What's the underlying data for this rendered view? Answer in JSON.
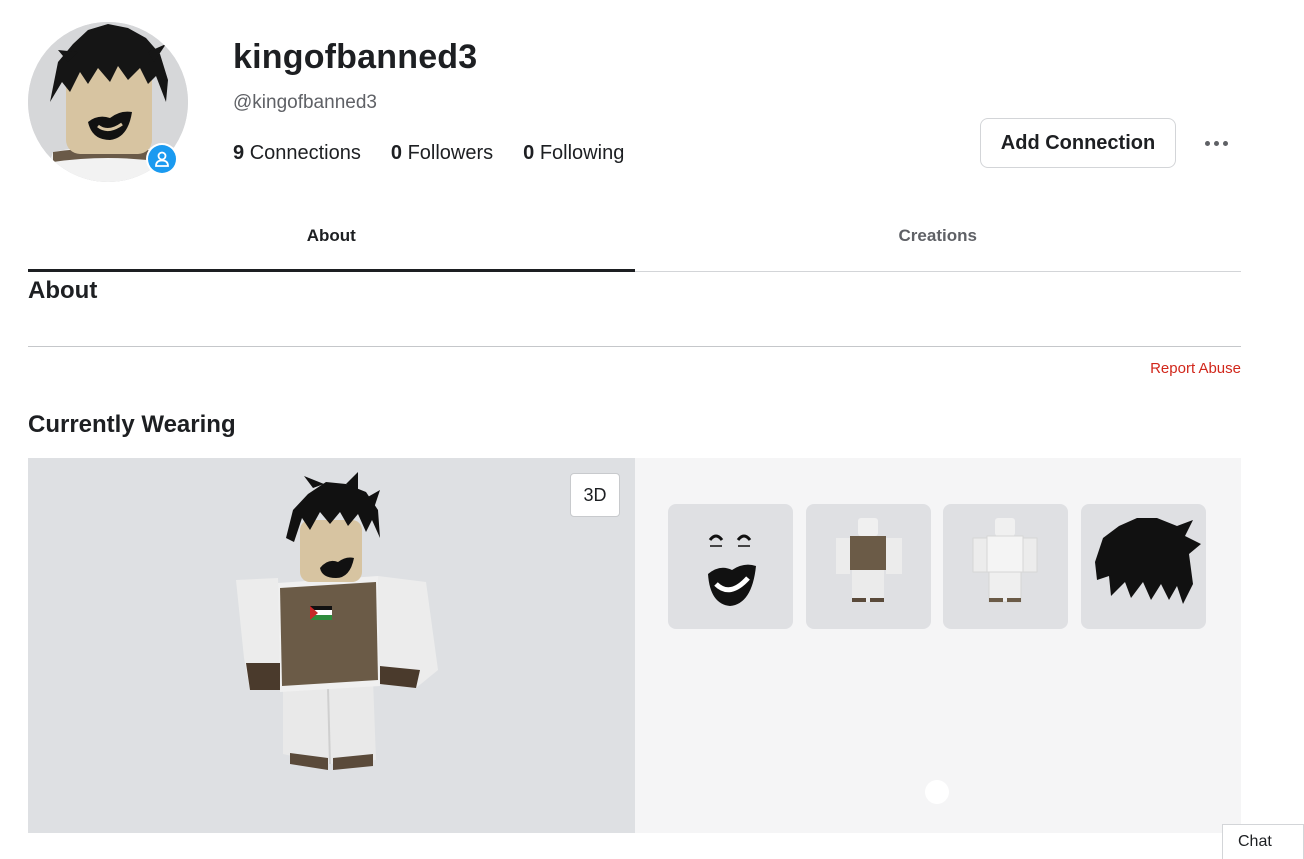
{
  "profile": {
    "display_name": "kingofbanned3",
    "username": "@kingofbanned3",
    "stats": [
      {
        "count": "9",
        "label": "Connections"
      },
      {
        "count": "0",
        "label": "Followers"
      },
      {
        "count": "0",
        "label": "Following"
      }
    ],
    "add_connection_label": "Add Connection",
    "presence_icon": "user-icon",
    "presence_color": "#1a9af0"
  },
  "tabs": [
    {
      "label": "About",
      "active": true
    },
    {
      "label": "Creations",
      "active": false
    }
  ],
  "about": {
    "heading": "About",
    "report_label": "Report Abuse",
    "report_color": "#d1271b"
  },
  "wearing": {
    "heading": "Currently Wearing",
    "view_mode_label": "3D",
    "items": [
      {
        "name": "face-item"
      },
      {
        "name": "outfit-vest-item"
      },
      {
        "name": "outfit-white-item"
      },
      {
        "name": "hair-item"
      }
    ]
  },
  "chat": {
    "label": "Chat"
  }
}
